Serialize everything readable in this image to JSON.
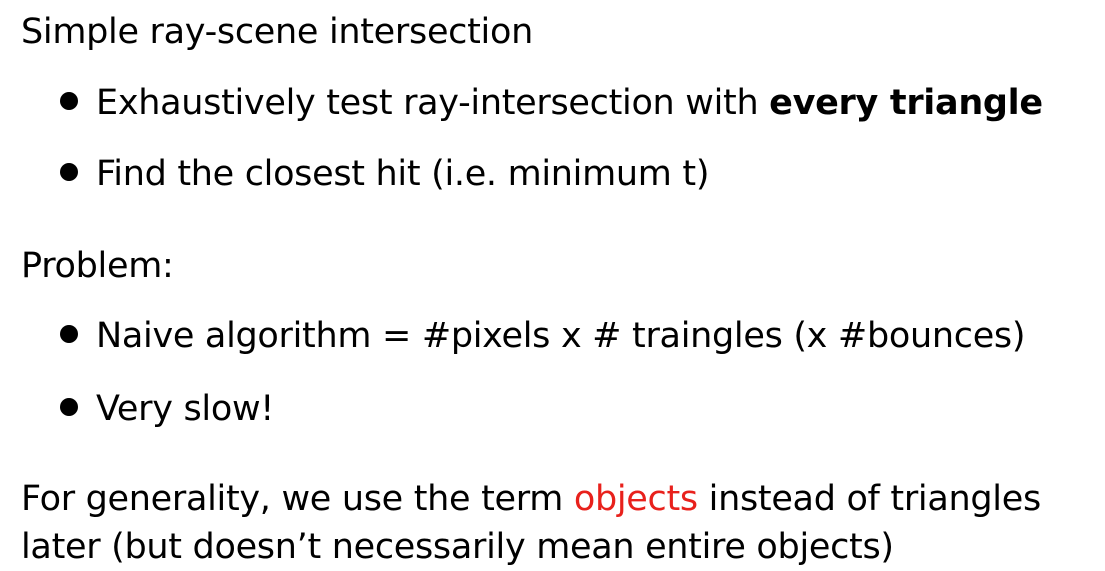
{
  "heading1": "Simple ray-scene intersection",
  "bullets1": [
    {
      "text": "Exhaustively test ray-intersection with ",
      "bold": "every triangle"
    },
    {
      "text": "Find the closest hit (i.e. minimum t)",
      "bold": ""
    }
  ],
  "heading2": "Problem:",
  "bullets2": [
    {
      "text": "Naive algorithm = #pixels x # traingles (x #bounces)"
    },
    {
      "text": "Very slow!"
    }
  ],
  "note": {
    "before": "For generality, we use the term ",
    "highlight": "objects",
    "after": " instead of triangles",
    "line2": "later (but doesn’t necessarily mean entire objects)"
  },
  "colors": {
    "highlight": "#e8211c"
  }
}
